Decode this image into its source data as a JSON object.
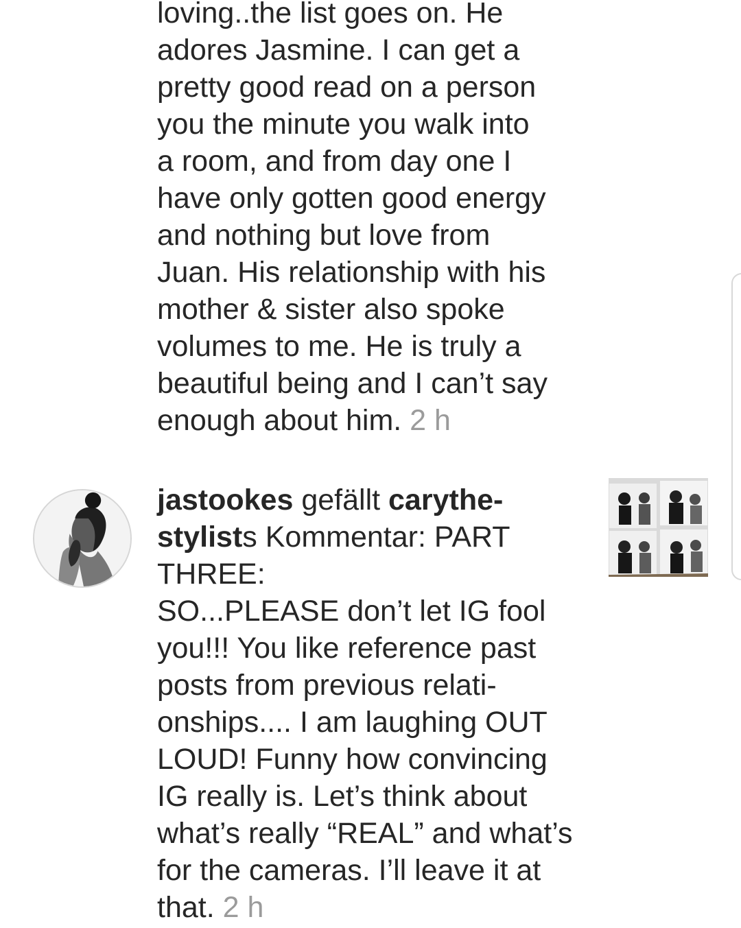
{
  "feed": {
    "first": {
      "text": "loving..the list goes on. He\nadores Jasmine. I can get a\npretty good read on a person\nyou the minute you walk into\na room, and from day one I\nhave only gotten good energy\nand nothing but love from\nJuan. His relationship with his\nmother & sister also spoke\nvolumes to me. He is truly a\nbeautiful being and I can’t say\nenough about him. ",
      "time": "2 h"
    },
    "second": {
      "user": "jastookes",
      "action_text": " gefällt ",
      "target_user": "carythe-\nstylist",
      "suffix": "s Kommentar: PART\nTHREE:\nSO...PLEASE don’t  let IG fool\nyou!!! You like reference past\nposts from previous  relati-\nonships.... I am laughing OUT\nLOUD! Funny how convincing\nIG really is. Let’s think about\nwhat’s really “REAL” and what’s\nfor the cameras. I’ll leave it at\nthat. ",
      "time": "2 h"
    }
  },
  "icons": {
    "avatar": "profile-photo-bw",
    "thumbnail": "photobooth-photo-grid"
  },
  "colors": {
    "text": "#262626",
    "time": "#9b9b9b",
    "background": "#ffffff"
  }
}
